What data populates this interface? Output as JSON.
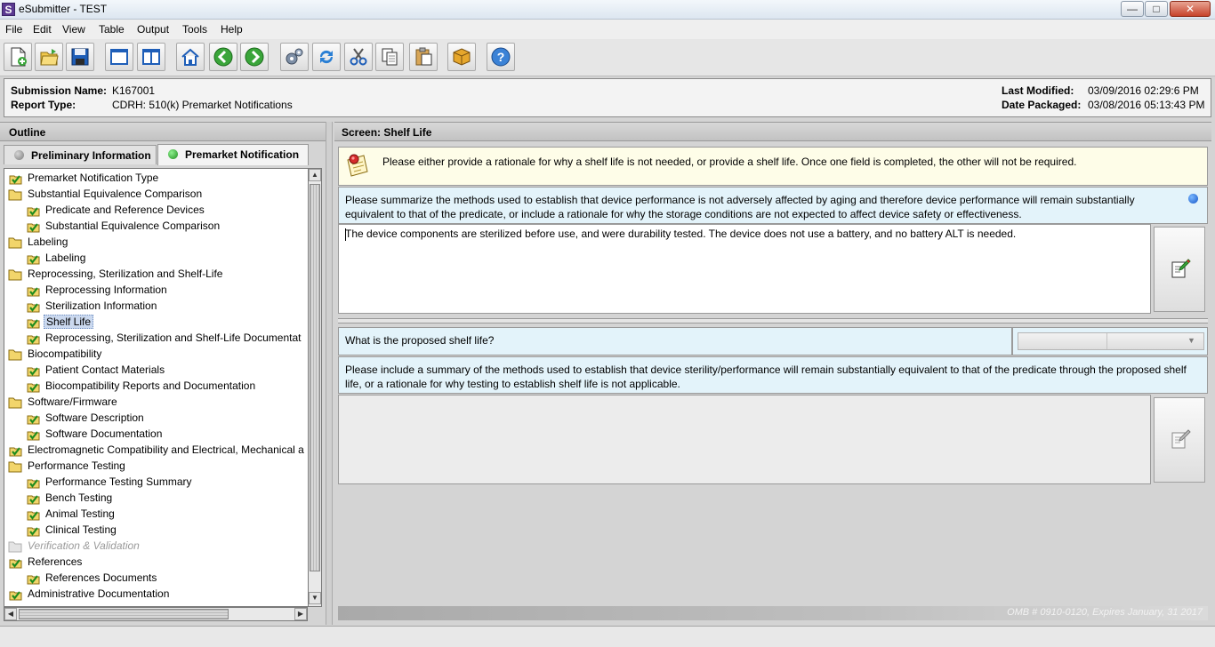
{
  "window": {
    "title": "eSubmitter - TEST",
    "icon_letter": "S",
    "minimize": "—",
    "maximize": "□",
    "close": "✕"
  },
  "menu": [
    {
      "label": "File"
    },
    {
      "label": "Edit"
    },
    {
      "label": "View"
    },
    {
      "label": "Table"
    },
    {
      "label": "Output"
    },
    {
      "label": "Tools"
    },
    {
      "label": "Help"
    }
  ],
  "toolbar": [
    {
      "name": "new-document-icon"
    },
    {
      "name": "open-folder-icon"
    },
    {
      "name": "save-icon"
    },
    {
      "name": "single-pane-icon"
    },
    {
      "name": "split-pane-icon"
    },
    {
      "name": "home-icon"
    },
    {
      "name": "back-arrow-icon"
    },
    {
      "name": "forward-arrow-icon"
    },
    {
      "name": "settings-gears-icon"
    },
    {
      "name": "refresh-icon"
    },
    {
      "name": "cut-scissors-icon"
    },
    {
      "name": "copy-icon"
    },
    {
      "name": "paste-icon"
    },
    {
      "name": "package-icon"
    },
    {
      "name": "help-icon"
    }
  ],
  "header": {
    "submission_name_label": "Submission Name:",
    "submission_name": "K167001",
    "report_type_label": "Report Type:",
    "report_type": "CDRH: 510(k) Premarket Notifications",
    "last_modified_label": "Last Modified:",
    "last_modified": "03/09/2016 02:29:6 PM",
    "date_packaged_label": "Date Packaged:",
    "date_packaged": "03/08/2016 05:13:43 PM"
  },
  "outline": {
    "title": "Outline",
    "tabs": [
      {
        "label": "Preliminary Information",
        "dot_color": "#8c8c8c",
        "active": false
      },
      {
        "label": "Premarket Notification",
        "dot_color": "#2fb12f",
        "active": true
      }
    ],
    "tree": [
      {
        "label": "Premarket Notification Type",
        "level": 0,
        "icon": "check"
      },
      {
        "label": "Substantial Equivalence Comparison",
        "level": 0,
        "icon": "folder"
      },
      {
        "label": "Predicate and Reference Devices",
        "level": 1,
        "icon": "check"
      },
      {
        "label": "Substantial Equivalence Comparison",
        "level": 1,
        "icon": "check"
      },
      {
        "label": "Labeling",
        "level": 0,
        "icon": "folder"
      },
      {
        "label": "Labeling",
        "level": 1,
        "icon": "check"
      },
      {
        "label": "Reprocessing, Sterilization and Shelf-Life",
        "level": 0,
        "icon": "folder"
      },
      {
        "label": "Reprocessing Information",
        "level": 1,
        "icon": "check"
      },
      {
        "label": "Sterilization Information",
        "level": 1,
        "icon": "check"
      },
      {
        "label": "Shelf Life",
        "level": 1,
        "icon": "check",
        "selected": true
      },
      {
        "label": "Reprocessing, Sterilization and Shelf-Life Documentat",
        "level": 1,
        "icon": "check"
      },
      {
        "label": "Biocompatibility",
        "level": 0,
        "icon": "folder"
      },
      {
        "label": "Patient Contact Materials",
        "level": 1,
        "icon": "check"
      },
      {
        "label": "Biocompatibility Reports and Documentation",
        "level": 1,
        "icon": "check"
      },
      {
        "label": "Software/Firmware",
        "level": 0,
        "icon": "folder"
      },
      {
        "label": "Software Description",
        "level": 1,
        "icon": "check"
      },
      {
        "label": "Software Documentation",
        "level": 1,
        "icon": "check"
      },
      {
        "label": "Electromagnetic Compatibility and Electrical, Mechanical a",
        "level": 0,
        "icon": "check"
      },
      {
        "label": "Performance Testing",
        "level": 0,
        "icon": "folder"
      },
      {
        "label": "Performance Testing Summary",
        "level": 1,
        "icon": "check"
      },
      {
        "label": "Bench Testing",
        "level": 1,
        "icon": "check"
      },
      {
        "label": "Animal Testing",
        "level": 1,
        "icon": "check"
      },
      {
        "label": "Clinical Testing",
        "level": 1,
        "icon": "check"
      },
      {
        "label": "Verification & Validation",
        "level": 0,
        "icon": "folder-disabled",
        "disabled": true
      },
      {
        "label": "References",
        "level": 0,
        "icon": "check"
      },
      {
        "label": "References Documents",
        "level": 1,
        "icon": "check"
      },
      {
        "label": "Administrative Documentation",
        "level": 0,
        "icon": "check"
      }
    ]
  },
  "screen": {
    "title": "Screen: Shelf Life",
    "notice": "Please either provide a rationale for why a shelf life is not needed, or provide a shelf life.  Once one field is completed, the other will not be required.",
    "q1": "Please summarize the methods used to establish that device performance is not adversely affected by aging and therefore device performance will remain substantially equivalent to that of the predicate, or include a rationale for why the storage conditions are not expected to affect device safety or effectiveness.",
    "a1": "The device components are sterilized before use, and were durability tested.  The device does not use a battery, and no battery ALT is needed.",
    "q2": "What is the proposed shelf life?",
    "q3": "Please include a summary of the methods used to establish that device sterility/performance will remain substantially equivalent to that of the predicate through the proposed shelf life, or a rationale for why testing to establish shelf life is not applicable.",
    "a3": "",
    "footer": "OMB # 0910-0120, Expires January, 31 2017"
  }
}
